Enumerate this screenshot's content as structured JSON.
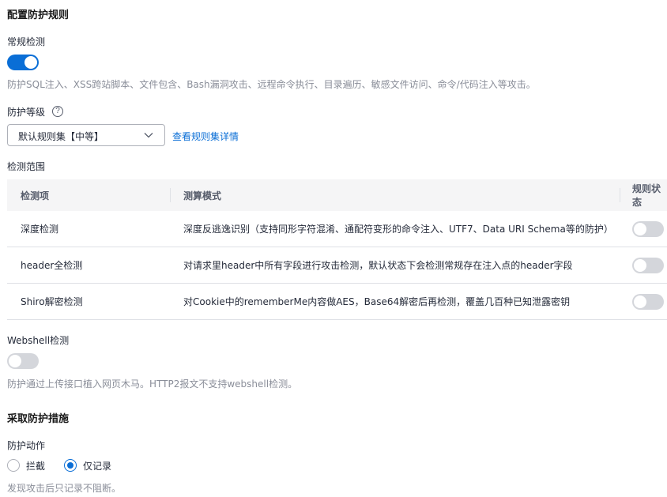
{
  "config_section": {
    "title": "配置防护规则",
    "regular_detection": {
      "label": "常规检测",
      "enabled": true,
      "description": "防护SQL注入、XSS跨站脚本、文件包含、Bash漏洞攻击、远程命令执行、目录遍历、敏感文件访问、命令/代码注入等攻击。"
    },
    "protection_level": {
      "label": "防护等级",
      "help_icon": "question-circle-icon",
      "help_glyph": "?",
      "selected": "默认规则集【中等】",
      "link": "查看规则集详情"
    },
    "detection_scope": {
      "label": "检测范围",
      "columns": [
        "检测项",
        "测算模式",
        "规则状态"
      ],
      "rows": [
        {
          "item": "深度检测",
          "mode": "深度反逃逸识别（支持同形字符混淆、通配符变形的命令注入、UTF7、Data URI Schema等的防护）",
          "enabled": false
        },
        {
          "item": "header全检测",
          "mode": "对请求里header中所有字段进行攻击检测，默认状态下会检测常规存在注入点的header字段",
          "enabled": false
        },
        {
          "item": "Shiro解密检测",
          "mode": "对Cookie中的rememberMe内容做AES，Base64解密后再检测，覆盖几百种已知泄露密钥",
          "enabled": false
        }
      ]
    },
    "webshell": {
      "label": "Webshell检测",
      "enabled": false,
      "description": "防护通过上传接口植入网页木马。HTTP2报文不支持webshell检测。"
    }
  },
  "action_section": {
    "title": "采取防护措施",
    "action_label": "防护动作",
    "options": [
      {
        "label": "拦截",
        "selected": false
      },
      {
        "label": "仅记录",
        "selected": true
      }
    ],
    "description": "发现攻击后只记录不阻断。"
  },
  "colors": {
    "accent": "#0a6ed6",
    "toggle_off": "#d4d6db",
    "muted_text": "#8a8e99",
    "table_header_bg": "#f5f5f6"
  }
}
